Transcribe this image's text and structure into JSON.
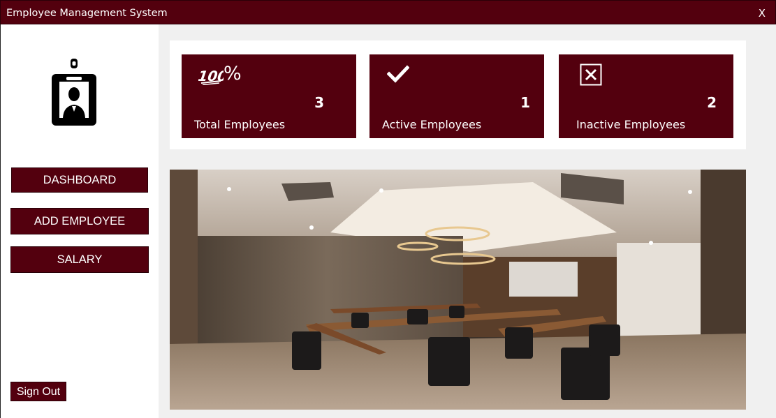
{
  "window": {
    "title": "Employee Management System",
    "close_label": "X"
  },
  "sidebar": {
    "logo_icon": "employee-id-badge-icon",
    "nav": [
      {
        "label": "DASHBOARD"
      },
      {
        "label": "ADD EMPLOYEE"
      },
      {
        "label": "SALARY"
      }
    ],
    "sign_out_label": "Sign Out"
  },
  "stats": [
    {
      "label": "Total Employees",
      "value": "3",
      "icon": "hundred-percent-icon",
      "icon_text": "%"
    },
    {
      "label": "Active Employees",
      "value": "1",
      "icon": "checkmark-icon"
    },
    {
      "label": "Inactive Employees",
      "value": "2",
      "icon": "x-box-icon"
    }
  ],
  "colors": {
    "accent": "#53000e",
    "background": "#f0f0f0",
    "panel": "#ffffff"
  },
  "banner": {
    "icon": "conference-room-photo"
  }
}
